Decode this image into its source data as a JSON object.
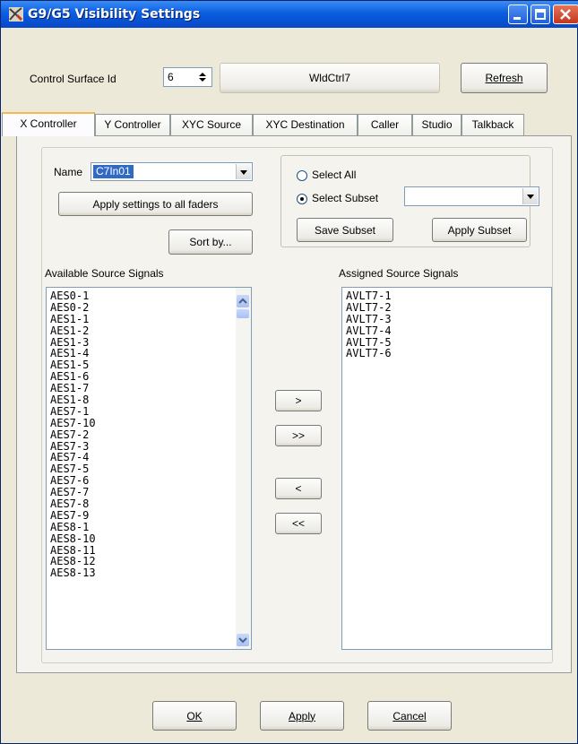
{
  "window": {
    "title": "G9/G5 Visibility Settings"
  },
  "top": {
    "control_surface_label": "Control Surface Id",
    "control_surface_value": "6",
    "surface_name": "WldCtrl7",
    "refresh_label": "Refresh"
  },
  "tabs": [
    {
      "label": "X Controller"
    },
    {
      "label": "Y Controller"
    },
    {
      "label": "XYC Source"
    },
    {
      "label": "XYC Destination"
    },
    {
      "label": "Caller"
    },
    {
      "label": "Studio"
    },
    {
      "label": "Talkback"
    }
  ],
  "panel": {
    "name_label": "Name",
    "name_value": "C7In01",
    "apply_all_label": "Apply settings to all faders",
    "sort_label": "Sort by...",
    "select_all_label": "Select All",
    "select_subset_label": "Select Subset",
    "subset_value": "",
    "selection_mode": "subset",
    "save_subset_label": "Save Subset",
    "apply_subset_label": "Apply Subset",
    "available_label": "Available Source Signals",
    "assigned_label": "Assigned Source Signals",
    "available": [
      "AES0-1",
      "AES0-2",
      "AES1-1",
      "AES1-2",
      "AES1-3",
      "AES1-4",
      "AES1-5",
      "AES1-6",
      "AES1-7",
      "AES1-8",
      "AES7-1",
      "AES7-10",
      "AES7-2",
      "AES7-3",
      "AES7-4",
      "AES7-5",
      "AES7-6",
      "AES7-7",
      "AES7-8",
      "AES7-9",
      "AES8-1",
      "AES8-10",
      "AES8-11",
      "AES8-12",
      "AES8-13"
    ],
    "assigned": [
      "AVLT7-1",
      "AVLT7-2",
      "AVLT7-3",
      "AVLT7-4",
      "AVLT7-5",
      "AVLT7-6"
    ],
    "move_right_label": ">",
    "move_all_right_label": ">>",
    "move_left_label": "<",
    "move_all_left_label": "<<"
  },
  "footer": {
    "ok_label": "OK",
    "apply_label": "Apply",
    "cancel_label": "Cancel"
  },
  "colors": {
    "titlebar": "#0a5ee0",
    "dialog": "#ece9d8",
    "selection": "#316ac5"
  }
}
